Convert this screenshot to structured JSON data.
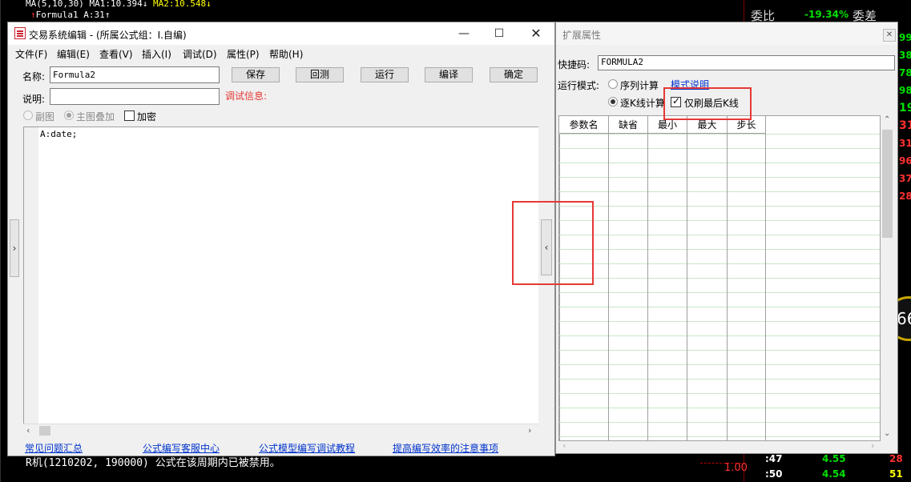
{
  "background": {
    "ma_line": "MA(5,10,30) MA1:10.394↓",
    "ma2": "MA2:10.548↓",
    "formula_line": "Formula1 A:31↑",
    "weibi_label": "委比",
    "weibi_value": "-19.34%",
    "weicha_label": "委差",
    "right_numbers": [
      "99",
      "38",
      "78",
      "98",
      "19",
      "31",
      "31",
      "96",
      "37",
      "28"
    ],
    "bottom_text": "R机(1210202, 190000)  公式在该周期内已被禁用。",
    "price_label": "1.00",
    "ticks": [
      {
        "time": ":47",
        "price": "4.55",
        "vol": "28"
      },
      {
        "time": ":50",
        "price": "4.54",
        "vol": "51"
      }
    ],
    "circle_value": "66"
  },
  "dialog": {
    "title": "交易系统编辑 - (所属公式组：I.自编)",
    "menu": [
      "文件(F)",
      "编辑(E)",
      "查看(V)",
      "插入(I)",
      "调试(D)",
      "属性(P)",
      "帮助(H)"
    ],
    "name_label": "名称:",
    "name_value": "Formula2",
    "desc_label": "说明:",
    "desc_value": "",
    "debug_label": "调试信息:",
    "buttons": {
      "save": "保存",
      "backtest": "回测",
      "run": "运行",
      "compile": "编译",
      "ok": "确定"
    },
    "options": {
      "sub_chart": "副图",
      "main_overlay": "主图叠加",
      "encrypt": "加密"
    },
    "code": "A:date;",
    "links": [
      "常见问题汇总",
      "公式编写客服中心",
      "公式模型编写调试教程",
      "提高编写效率的注意事项"
    ],
    "collapse_left": "›",
    "collapse_right": "‹"
  },
  "ext_panel": {
    "title": "扩展属性",
    "shortcut_label": "快捷码:",
    "shortcut_value": "FORMULA2",
    "run_mode_label": "运行模式:",
    "mode_series": "序列计算",
    "mode_link": "模式说明",
    "mode_bar": "逐K线计算",
    "refresh_last": "仅刷最后K线",
    "columns": [
      "参数名",
      "缺省",
      "最小",
      "最大",
      "步长"
    ]
  },
  "colors": {
    "accent_red": "#e53935",
    "link_blue": "#0033cc"
  }
}
